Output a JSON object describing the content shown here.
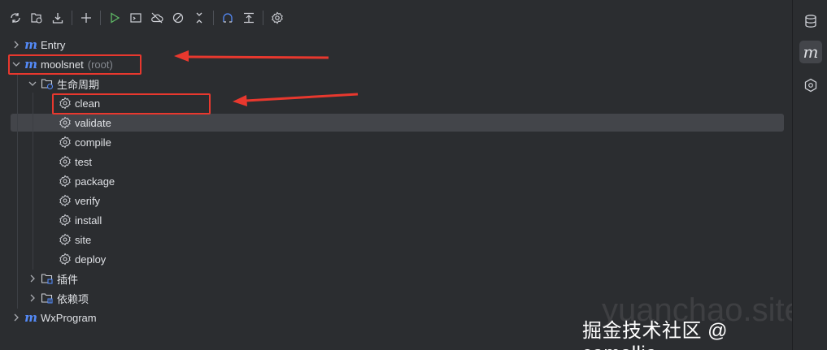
{
  "toolbar": {
    "buttons": [
      {
        "icon": "refresh-icon"
      },
      {
        "icon": "add-project-icon"
      },
      {
        "icon": "download-icon"
      },
      {
        "icon": "plus-icon"
      },
      {
        "icon": "run-icon"
      },
      {
        "icon": "execute-goal-icon"
      },
      {
        "icon": "offline-icon"
      },
      {
        "icon": "skip-tests-icon"
      },
      {
        "icon": "collapse-icon"
      },
      {
        "icon": "show-dependencies-icon"
      },
      {
        "icon": "align-top-icon"
      },
      {
        "icon": "settings-icon"
      }
    ]
  },
  "tree": {
    "entry": {
      "label": "Entry"
    },
    "root": {
      "label": "moolsnet",
      "tag": "(root)"
    },
    "lifecycle": {
      "label": "生命周期"
    },
    "goals": [
      "clean",
      "validate",
      "compile",
      "test",
      "package",
      "verify",
      "install",
      "site",
      "deploy"
    ],
    "plugins": {
      "label": "插件"
    },
    "dependencies": {
      "label": "依赖项"
    },
    "wxprogram": {
      "label": "WxProgram"
    }
  },
  "right_bar": {
    "items": [
      {
        "icon": "database-icon"
      },
      {
        "icon": "maven-icon",
        "label": "m"
      },
      {
        "icon": "hexagon-icon"
      }
    ]
  },
  "watermark": {
    "text": "掘金技术社区 @ camellia",
    "ghost": "yuanchao.site"
  },
  "colors": {
    "accent": "#548af7",
    "annotation": "#e8382e",
    "run": "#5fb865",
    "selected": "#43454a"
  }
}
